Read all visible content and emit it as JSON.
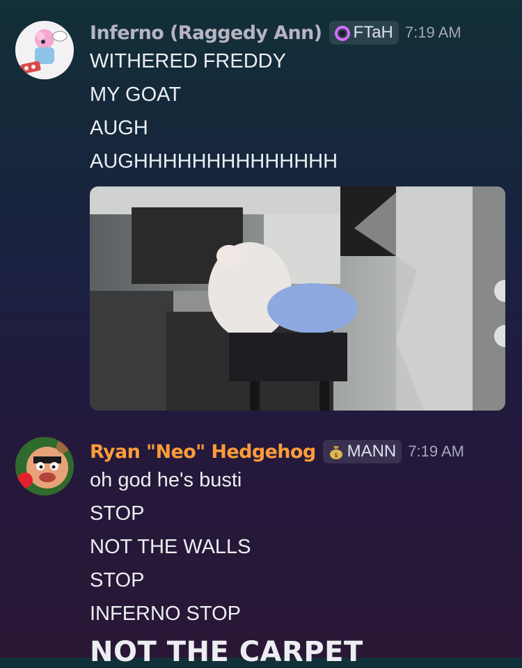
{
  "messages": [
    {
      "author": "Inferno (Raggedy Ann)",
      "author_color": "#b8b4c2",
      "tag": "FTaH",
      "tag_icon": "pink-ring-icon",
      "time": "7:19 AM",
      "lines": [
        "WITHERED FREDDY",
        "MY GOAT",
        "AUGH",
        "AUGHHHHHHHHHHHHHH"
      ],
      "attachment": "gif-image"
    },
    {
      "author": "Ryan \"Neo\" Hedgehog",
      "author_color": "#ff9c3a",
      "tag": "MANN",
      "tag_icon": "money-bag-icon",
      "time": "7:19 AM",
      "lines": [
        "oh god he's busti",
        "STOP",
        "NOT THE WALLS",
        "STOP",
        "INFERNO STOP"
      ],
      "heading_line": "NOT THE CARPET"
    }
  ]
}
